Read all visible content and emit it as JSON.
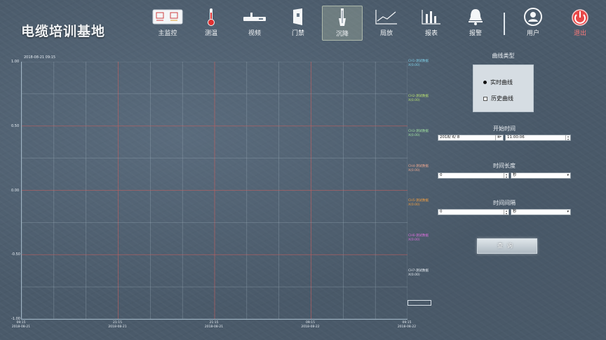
{
  "app": {
    "title": "电缆培训基地"
  },
  "nav": [
    {
      "label": "主监控",
      "icon": "monitor-icon"
    },
    {
      "label": "测温",
      "icon": "thermometer-icon"
    },
    {
      "label": "视频",
      "icon": "video-camera-icon"
    },
    {
      "label": "门禁",
      "icon": "door-icon"
    },
    {
      "label": "沉降",
      "icon": "settlement-icon",
      "active": true
    },
    {
      "label": "局放",
      "icon": "partial-discharge-icon"
    },
    {
      "label": "报表",
      "icon": "report-icon"
    },
    {
      "label": "报警",
      "icon": "alarm-bell-icon"
    },
    {
      "label": "用户",
      "icon": "user-icon"
    },
    {
      "label": "退出",
      "icon": "power-icon",
      "color": "#ff7a7a"
    }
  ],
  "chart": {
    "timestamp": "2018-08-21 09:15"
  },
  "chart_data": {
    "type": "line",
    "ylim": [
      -1.0,
      1.0
    ],
    "yticks": [
      "1.00",
      "0.50",
      "0.00",
      "-0.50",
      "-1.00"
    ],
    "x_ticks": [
      {
        "time": "09:15",
        "date": "2018-08-21"
      },
      {
        "time": "21:15",
        "date": "2018-08-21"
      },
      {
        "time": "21:15",
        "date": "2018-08-21"
      },
      {
        "time": "09:15",
        "date": "2018-08-22"
      },
      {
        "time": "09:15",
        "date": "2018-08-22"
      }
    ],
    "grid": true,
    "legend": [
      {
        "name": "CH1-测试数据",
        "value": "X(0.00)",
        "color": "#7fd0e8"
      },
      {
        "name": "CH2-测试数据",
        "value": "X(0.00)",
        "color": "#b8e070"
      },
      {
        "name": "CH3-测试数据",
        "value": "X(0.00)",
        "color": "#9fe0a0"
      },
      {
        "name": "CH4-测试数据",
        "value": "X(0.00)",
        "color": "#f0a890"
      },
      {
        "name": "CH5-测试数据",
        "value": "X(0.00)",
        "color": "#f5a040"
      },
      {
        "name": "CH6-测试数据",
        "value": "X(0.00)",
        "color": "#e070e0"
      },
      {
        "name": "CH7-测试数据",
        "value": "X(0.00)",
        "color": "#e8eef4"
      }
    ]
  },
  "panel": {
    "curve_type_label": "曲线类型",
    "radio_realtime": "实时曲线",
    "radio_history": "历史曲线",
    "start_time_label": "开始时间",
    "start_date": "2018/ 6/ 8",
    "start_clock": "11:00:06",
    "duration_label": "时间长度",
    "duration_value": "0",
    "duration_unit": "秒",
    "interval_label": "时间间隔",
    "interval_value": "0",
    "interval_unit": "秒",
    "query_label": "查询"
  },
  "colors": {
    "grid_major": "#c06060",
    "grid_minor": "#9fb0bc",
    "background": "#4a5a6a"
  }
}
